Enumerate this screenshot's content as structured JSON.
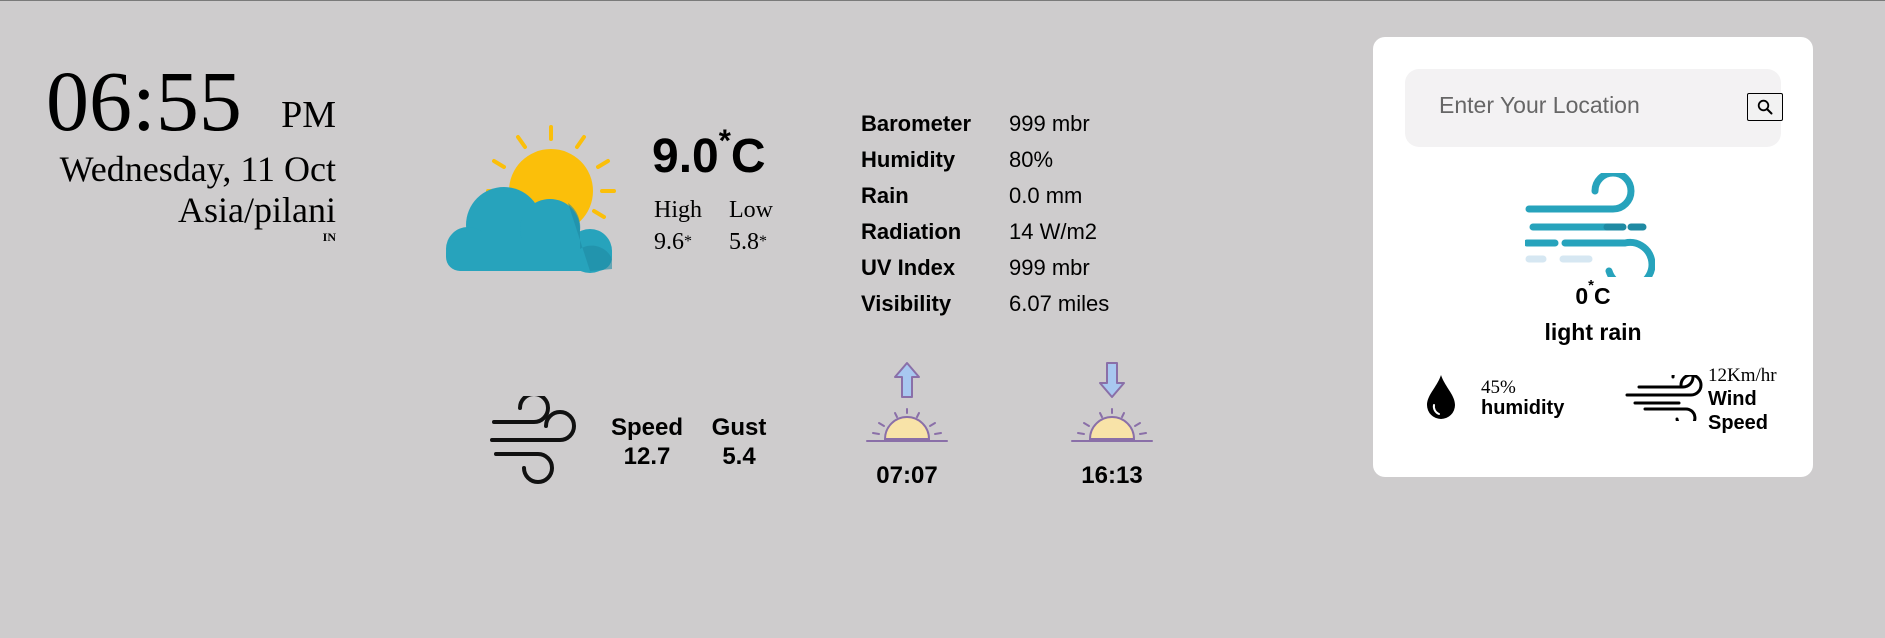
{
  "clock": {
    "time": "06:55",
    "ampm": "PM",
    "date": "Wednesday, 11 Oct",
    "timezone": "Asia/pilani",
    "country": "IN"
  },
  "current": {
    "temp_value": "9.0",
    "temp_degree": "*",
    "temp_unit": "C",
    "high_label": "High",
    "low_label": "Low",
    "high_value": "9.6",
    "low_value": "5.8",
    "degree_mark": "*",
    "icon": "partly-cloudy-icon"
  },
  "details": [
    {
      "label": "Barometer",
      "value": "999 mbr"
    },
    {
      "label": "Humidity",
      "value": "80%"
    },
    {
      "label": "Rain",
      "value": "0.0 mm"
    },
    {
      "label": "Radiation",
      "value": "14 W/m2"
    },
    {
      "label": "UV Index",
      "value": "999 mbr"
    },
    {
      "label": "Visibility",
      "value": "6.07 miles"
    }
  ],
  "wind": {
    "speed_label": "Speed",
    "speed_value": "12.7",
    "gust_label": "Gust",
    "gust_value": "5.4",
    "icon": "wind-icon"
  },
  "sun": {
    "sunrise": "07:07",
    "sunset": "16:13"
  },
  "search_card": {
    "placeholder": "Enter Your Location",
    "temp_value": "0",
    "temp_degree": "*",
    "temp_unit": "C",
    "description": "light rain",
    "humidity_value": "45%",
    "humidity_label": "humidity",
    "wind_speed_value": "12Km/hr",
    "wind_speed_label": "Wind Speed"
  },
  "colors": {
    "background": "#cecccd",
    "sun": "#fbbf0a",
    "cloud": "#27a3bc",
    "sunrise_arrow": "#a8c8f0",
    "sun_base": "#f8e3a8"
  }
}
